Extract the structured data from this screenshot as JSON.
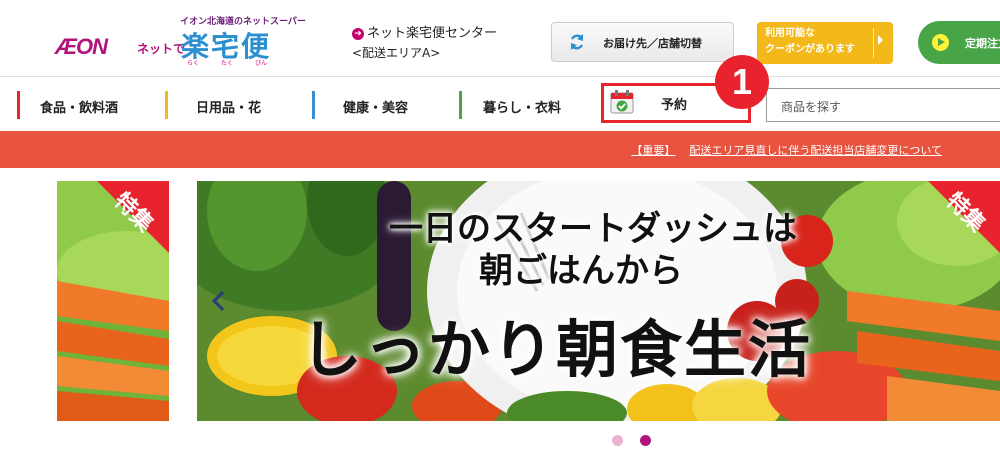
{
  "header": {
    "logo": {
      "tagline": "イオン北海道のネットスーパー",
      "brand": "ÆON",
      "prefix": "ネットで",
      "name": "楽宅便",
      "ruby": [
        "らく",
        "たく",
        "びん"
      ]
    },
    "center": {
      "arrow": "➜",
      "name": "ネット楽宅便センター",
      "area": "<配送エリアA>"
    },
    "delivery_button": {
      "label": "お届け先／店舗切替",
      "icon": "refresh-icon"
    },
    "coupon_button": {
      "label": "利用可能な\nクーポンがあります"
    },
    "regular_button": {
      "label": "定期注文"
    },
    "step_badge": "1"
  },
  "nav": {
    "items": [
      {
        "label": "食品・飲料酒",
        "color": "#e8232d"
      },
      {
        "label": "日用品・花",
        "color": "#f3b91a"
      },
      {
        "label": "健康・美容",
        "color": "#3a8fd0"
      },
      {
        "label": "暮らし・衣料",
        "color": "#47a548"
      }
    ],
    "reserve": {
      "label": "予約",
      "icon": "calendar-check-icon"
    },
    "search": {
      "placeholder": "商品を探す"
    }
  },
  "notice": {
    "tag": "【重要】",
    "text": "配送エリア見直しに伴う配送担当店舗変更について"
  },
  "banner": {
    "headline_1": "一日のスタートダッシュは",
    "headline_2": "朝ごはんから",
    "headline_3": "しっかり朝食生活",
    "ribbon": "特集",
    "slide_count": 2,
    "active_slide": 2
  },
  "colors": {
    "accent_red": "#e8232d",
    "notice_bg": "#e8533f",
    "coupon": "#f3b91a",
    "regular": "#47a548",
    "brand": "#b0147a",
    "dot_inactive": "#e8b4cf",
    "dot_active": "#b0147a"
  }
}
